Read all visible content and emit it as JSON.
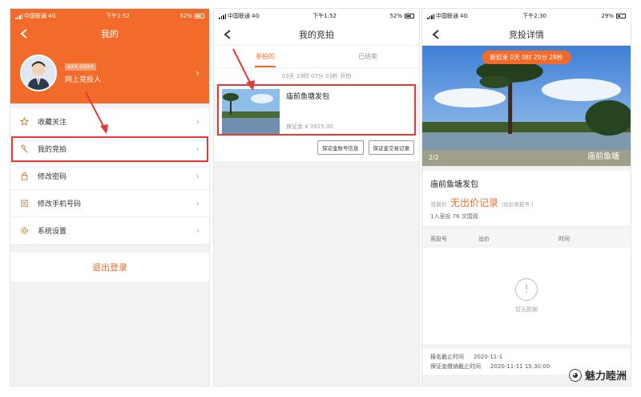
{
  "screen1": {
    "status": {
      "carrier": "中国联通",
      "network": "4G",
      "time": "下午1:52",
      "battery": "52%"
    },
    "title": "我的",
    "profile": {
      "id_masked": "AXX XXXX",
      "role": "网上竞投人"
    },
    "menu": [
      {
        "label": "收藏关注",
        "icon": "star-icon",
        "highlighted": false
      },
      {
        "label": "我的竞拍",
        "icon": "gavel-icon",
        "highlighted": true
      },
      {
        "label": "修改密码",
        "icon": "lock-icon",
        "highlighted": false
      },
      {
        "label": "修改手机号码",
        "icon": "phone-icon",
        "highlighted": false
      },
      {
        "label": "系统设置",
        "icon": "gear-icon",
        "highlighted": false
      }
    ],
    "logout_label": "退出登录"
  },
  "screen2": {
    "status": {
      "carrier": "中国联通",
      "network": "4G",
      "time": "下午1:52",
      "battery": "52%"
    },
    "title": "我的竞拍",
    "tabs": [
      {
        "label": "参拍的",
        "active": true
      },
      {
        "label": "已结束",
        "active": false
      }
    ],
    "start_time": "03天 19时 07分 03秒 开拍",
    "item": {
      "title": "庙前鱼塘发包",
      "deposit": "保证金 ¥ 3915.00"
    },
    "buttons": {
      "deposit_account": "保证金账号信息",
      "deposit_records": "保证金交易记录"
    }
  },
  "screen3": {
    "status": {
      "carrier": "中国联通",
      "network": "4G",
      "time": "下午2:30",
      "battery": "29%"
    },
    "title": "竞投详情",
    "countdown": "距结束 0天 0时 29分 28秒",
    "page_indicator": "2/2",
    "image_caption": "庙前鱼塘",
    "item_title": "庙前鱼塘发包",
    "current_price_label": "当前价",
    "current_price_value": "无出价记录",
    "bid_number_hint": "(出价竞投号:)",
    "stats": "1人竞投  76 次围观",
    "table_headers": {
      "bid_no": "竞投号",
      "price": "出价",
      "time": "时间"
    },
    "empty_text": "暂无数据",
    "footer": [
      {
        "label": "报名截止时间",
        "value": "2020-11-1"
      },
      {
        "label": "保证金缴纳截止时间",
        "value": "2020-11-11 15:30:00"
      }
    ]
  },
  "watermark": "魅力睦洲",
  "colors": {
    "brand_orange": "#f26b2a",
    "highlight_red": "#e53935"
  }
}
